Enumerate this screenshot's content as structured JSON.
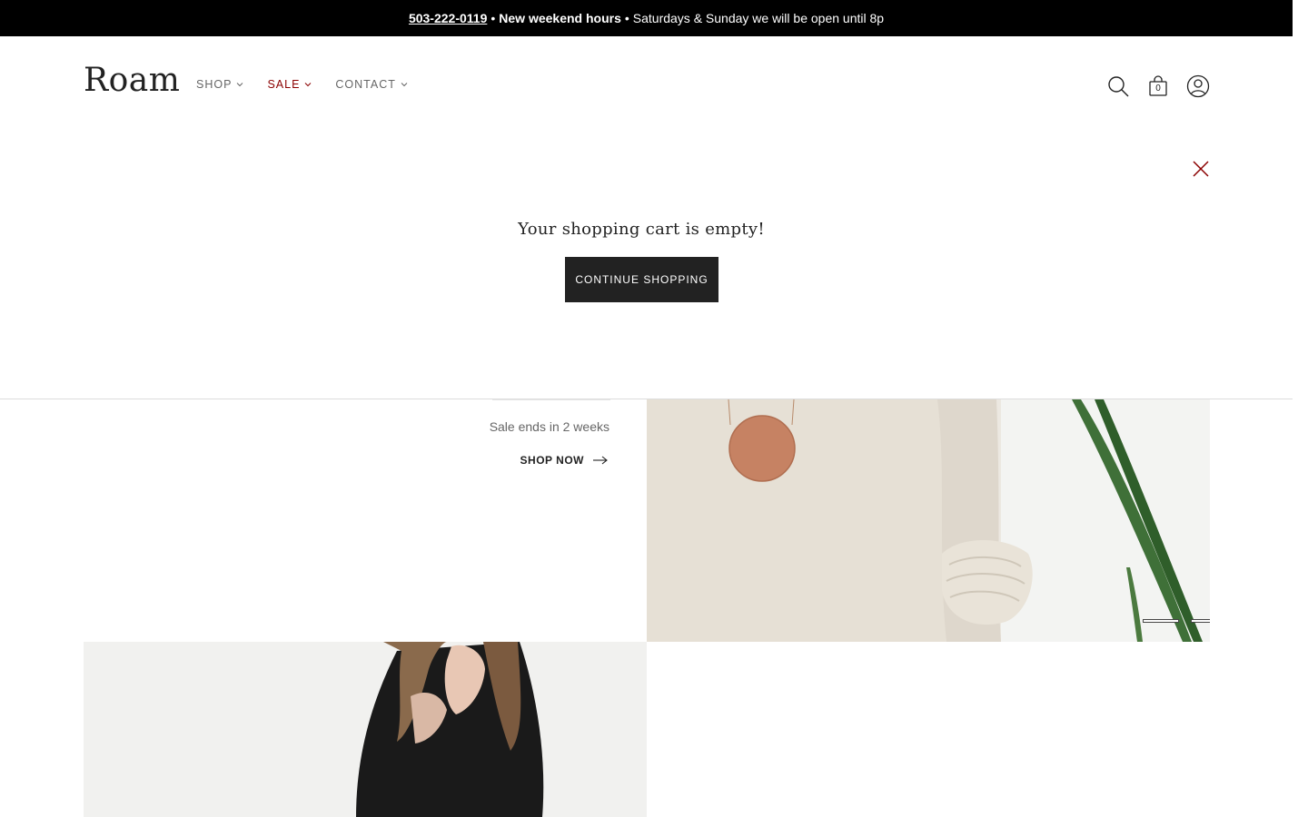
{
  "announcement": {
    "phone": "503-222-0119",
    "bullet1": "•",
    "headline": "New weekend hours",
    "bullet2": "•",
    "message": "Saturdays & Sunday we will be open until 8p"
  },
  "header": {
    "logo": "Roam",
    "nav": [
      {
        "label": "SHOP"
      },
      {
        "label": "SALE"
      },
      {
        "label": "CONTACT"
      }
    ],
    "cart_count": "0"
  },
  "cart": {
    "empty_message": "Your shopping cart is empty!",
    "continue_label": "CONTINUE SHOPPING"
  },
  "hero": {
    "sale_ends": "Sale ends in 2 weeks",
    "shop_now": "SHOP NOW"
  },
  "colors": {
    "announcement_bg": "#000000",
    "sale_accent": "#8b0000",
    "button_bg": "#222222"
  },
  "icons": [
    "search-icon",
    "cart-icon",
    "account-icon",
    "close-icon",
    "chevron-down-icon",
    "arrow-right-icon"
  ]
}
